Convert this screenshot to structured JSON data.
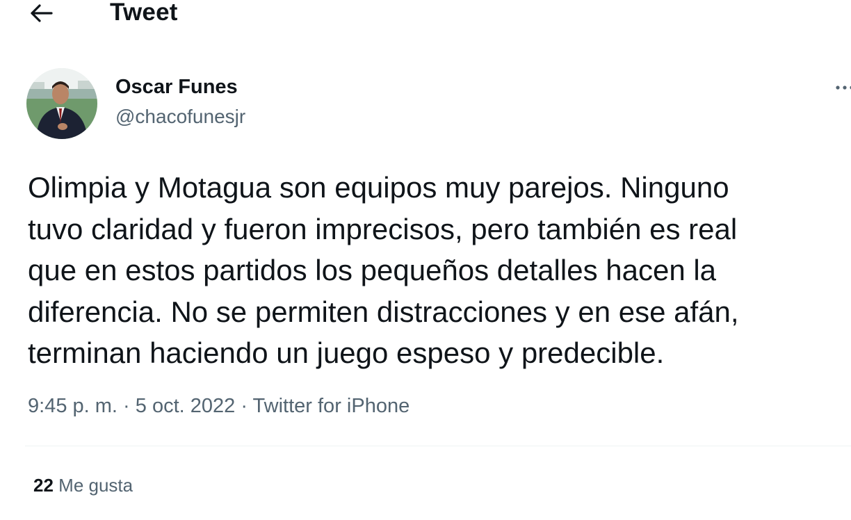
{
  "header": {
    "back_icon": "arrow-left-icon",
    "title": "Tweet"
  },
  "tweet": {
    "author": {
      "name": "Oscar Funes",
      "handle": "@chacofunesjr",
      "avatar_icon": "profile-photo"
    },
    "more_icon": "more-horizontal-icon",
    "text": "Olimpia y Motagua son equipos muy parejos. Ninguno\ntuvo claridad y fueron imprecisos, pero también es real\nque en estos partidos los pequeños detalles hacen la\ndiferencia. No se permiten distracciones y en ese afán,\nterminan haciendo un juego espeso y predecible.",
    "time": "9:45 p. m.",
    "separator": "·",
    "date": "5 oct. 2022",
    "source": "Twitter for iPhone",
    "likes": {
      "count": "22",
      "label": "Me gusta"
    }
  },
  "colors": {
    "text_primary": "#0f1419",
    "text_secondary": "#536471",
    "divider": "#eff3f4"
  }
}
